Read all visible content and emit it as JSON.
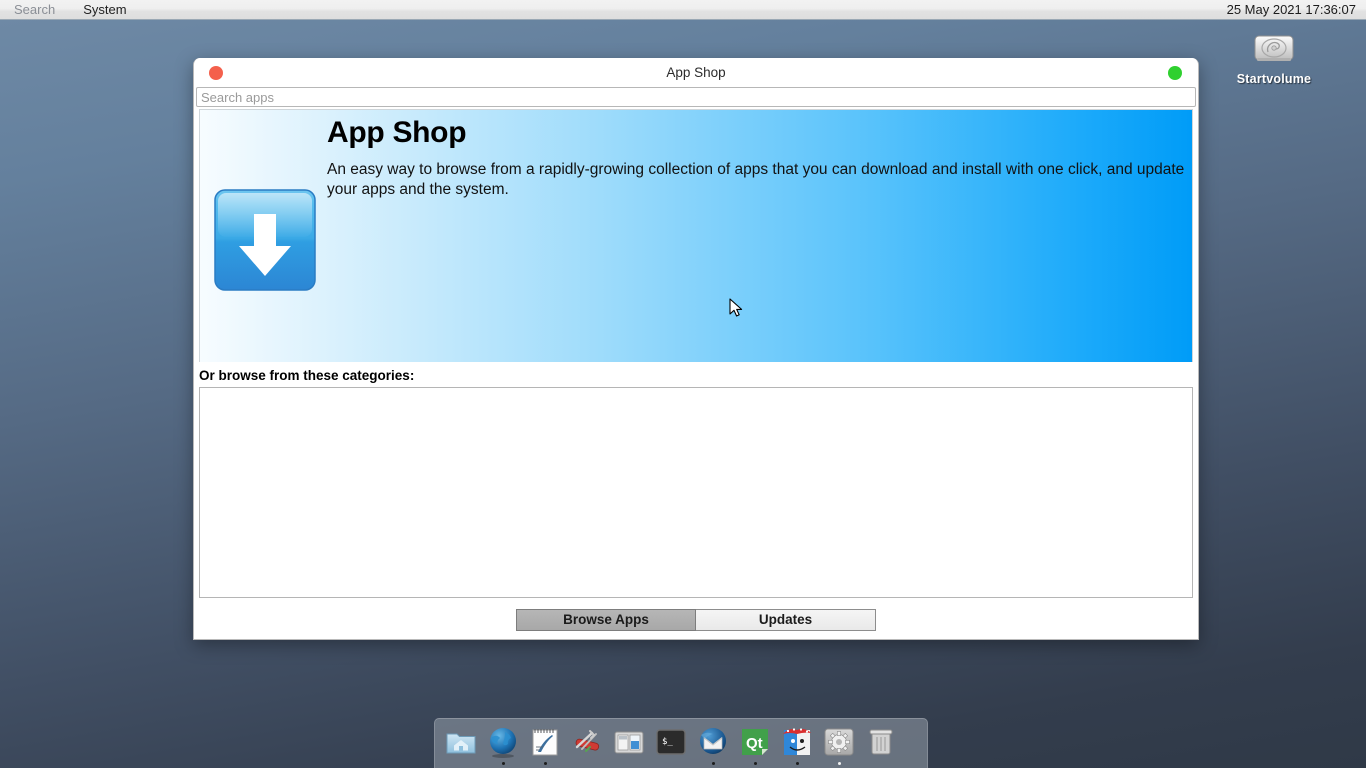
{
  "menubar": {
    "items": [
      {
        "label": "Search",
        "dim": true,
        "name": "menu-search"
      },
      {
        "label": "System",
        "dim": false,
        "name": "menu-system"
      }
    ],
    "datetime": "25 May 2021 17:36:07"
  },
  "desktop": {
    "icon": {
      "label": "Startvolume",
      "icon": "hard-drive-icon"
    }
  },
  "window": {
    "title": "App Shop",
    "close_button": "close-button",
    "zoom_button": "zoom-button",
    "search": {
      "placeholder": "Search apps",
      "value": ""
    },
    "banner": {
      "icon": "download-arrow-icon",
      "heading": "App Shop",
      "description": "An easy way to browse from a rapidly-growing collection of apps that you can download and install with one click, and update your apps and the system.",
      "gradient_start": "#f7fcff",
      "gradient_end": "#009cf8"
    },
    "categories": {
      "label": "Or browse from these categories:",
      "items": []
    },
    "tabs": [
      {
        "label": "Browse Apps",
        "active": true,
        "name": "tab-browse-apps"
      },
      {
        "label": "Updates",
        "active": false,
        "name": "tab-updates"
      }
    ]
  },
  "dock": {
    "items": [
      {
        "name": "home-folder-icon",
        "label": "Home",
        "running": "dark-none"
      },
      {
        "name": "web-browser-icon",
        "label": "Web Browser",
        "running": "dark"
      },
      {
        "name": "text-editor-icon",
        "label": "Text Editor",
        "running": "dark"
      },
      {
        "name": "tools-icon",
        "label": "Tools",
        "running": "none"
      },
      {
        "name": "display-settings-icon",
        "label": "Display Settings",
        "running": "none"
      },
      {
        "name": "terminal-icon",
        "label": "Terminal",
        "running": "none"
      },
      {
        "name": "mail-client-icon",
        "label": "Mail",
        "running": "dark"
      },
      {
        "name": "qt-icon",
        "label": "Qt",
        "running": "dark"
      },
      {
        "name": "file-manager-icon",
        "label": "Filer",
        "running": "dark"
      },
      {
        "name": "settings-gear-icon",
        "label": "Settings",
        "running": "light"
      },
      {
        "name": "trash-icon",
        "label": "Trash",
        "running": "none"
      }
    ]
  },
  "colors": {
    "accent_blue": "#009cf8",
    "close_red": "#f4604c",
    "zoom_green": "#2fd02f",
    "desktop_top": "#6f8aa6",
    "desktop_bottom": "#2f3947"
  }
}
